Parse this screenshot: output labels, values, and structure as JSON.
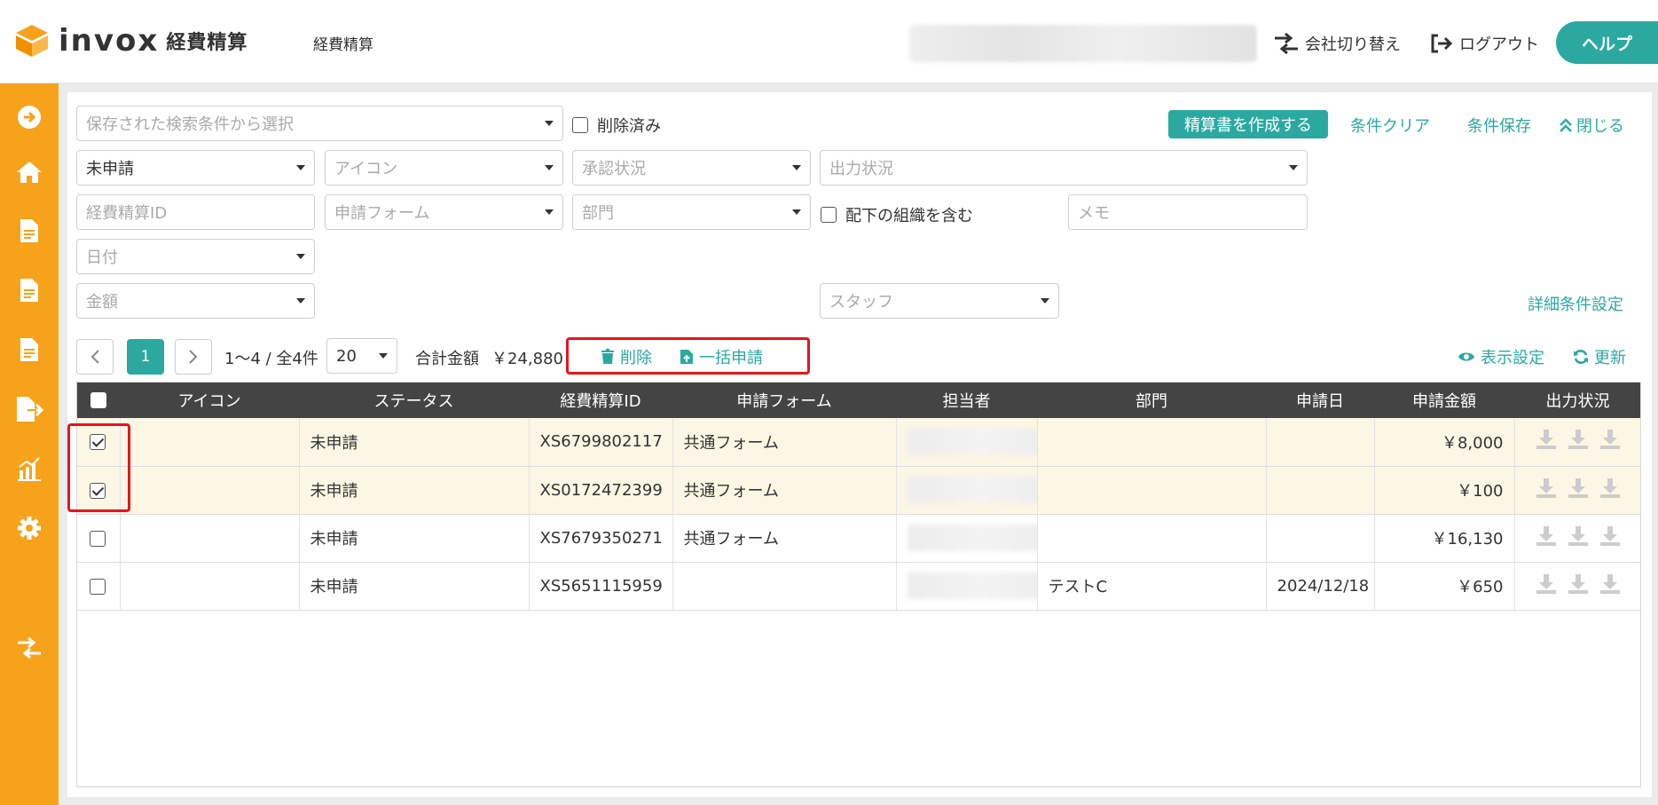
{
  "app": {
    "logo_text": "invox",
    "logo_sub": "経費精算",
    "page_title": "経費精算"
  },
  "header": {
    "switch_company": "会社切り替え",
    "logout": "ログアウト",
    "help": "ヘルプ"
  },
  "sidebar": {
    "items": [
      "arrow-circle-icon",
      "home-icon",
      "document-icon",
      "document-icon",
      "document-icon",
      "export-icon",
      "chart-icon",
      "gear-icon",
      "switch-icon"
    ]
  },
  "filters": {
    "saved_search_placeholder": "保存された検索条件から選択",
    "deleted_label": "削除済み",
    "create_report": "精算書を作成する",
    "clear": "条件クリア",
    "save": "条件保存",
    "close": "閉じる",
    "status_value": "未申請",
    "icon_placeholder": "アイコン",
    "approval_placeholder": "承認状況",
    "output_placeholder": "出力状況",
    "expense_id_placeholder": "経費精算ID",
    "form_placeholder": "申請フォーム",
    "dept_placeholder": "部門",
    "include_sub_label": "配下の組織を含む",
    "memo_placeholder": "メモ",
    "date_placeholder": "日付",
    "amount_placeholder": "金額",
    "staff_placeholder": "スタッフ",
    "advanced": "詳細条件設定"
  },
  "pagination": {
    "current_page": "1",
    "range": "1〜4 / 全4件",
    "per_page": "20",
    "total_label": "合計金額",
    "total_value": "￥24,880",
    "delete": "削除",
    "bulk_apply": "一括申請",
    "display_settings": "表示設定",
    "refresh": "更新"
  },
  "table": {
    "headers": [
      "アイコン",
      "ステータス",
      "経費精算ID",
      "申請フォーム",
      "担当者",
      "部門",
      "申請日",
      "申請金額",
      "出力状況"
    ],
    "rows": [
      {
        "checked": true,
        "status": "未申請",
        "id": "XS6799802117",
        "form": "共通フォーム",
        "dept": "",
        "date": "",
        "amount": "￥8,000"
      },
      {
        "checked": true,
        "status": "未申請",
        "id": "XS0172472399",
        "form": "共通フォーム",
        "dept": "",
        "date": "",
        "amount": "￥100"
      },
      {
        "checked": false,
        "status": "未申請",
        "id": "XS7679350271",
        "form": "共通フォーム",
        "dept": "",
        "date": "",
        "amount": "￥16,130"
      },
      {
        "checked": false,
        "status": "未申請",
        "id": "XS5651115959",
        "form": "",
        "dept": "テストC",
        "date": "2024/12/18",
        "amount": "￥650"
      }
    ]
  },
  "colors": {
    "accent": "#2ba9a0",
    "sidebar": "#f7a21b",
    "table_header": "#444444",
    "selected_row": "#fcf6e4",
    "highlight": "#e8141c"
  }
}
